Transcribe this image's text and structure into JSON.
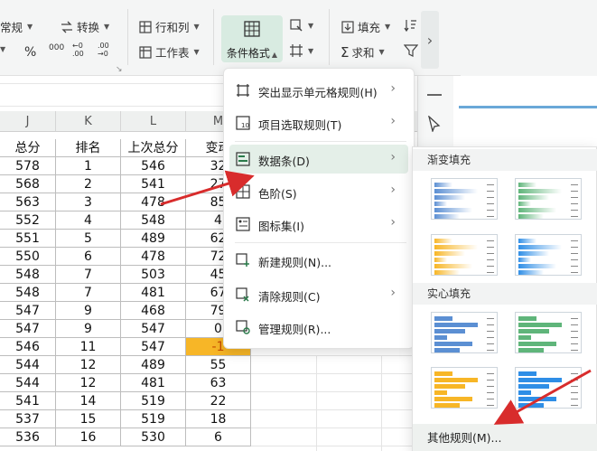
{
  "ribbon": {
    "number_format": "常规",
    "percent": "%",
    "thousands": "000",
    "dec_inc": "←0 .00",
    "dec_dec": ".00 →0",
    "convert": "转换",
    "rows_cols": "行和列",
    "worksheet": "工作表",
    "conditional_format": "条件格式",
    "fill": "填充",
    "sum": "求和"
  },
  "columns": [
    "J",
    "K",
    "L",
    "M"
  ],
  "table_headers": [
    "总分",
    "排名",
    "上次总分",
    "变动"
  ],
  "rows": [
    [
      "578",
      "1",
      "546",
      "32"
    ],
    [
      "568",
      "2",
      "541",
      "27"
    ],
    [
      "563",
      "3",
      "478",
      "85"
    ],
    [
      "552",
      "4",
      "548",
      "4"
    ],
    [
      "551",
      "5",
      "489",
      "62"
    ],
    [
      "550",
      "6",
      "478",
      "72"
    ],
    [
      "548",
      "7",
      "503",
      "45"
    ],
    [
      "548",
      "7",
      "481",
      "67"
    ],
    [
      "547",
      "9",
      "468",
      "79"
    ],
    [
      "547",
      "9",
      "547",
      "0"
    ],
    [
      "546",
      "11",
      "547",
      "-1"
    ],
    [
      "544",
      "12",
      "489",
      "55"
    ],
    [
      "544",
      "12",
      "481",
      "63"
    ],
    [
      "541",
      "14",
      "519",
      "22"
    ],
    [
      "537",
      "15",
      "519",
      "18"
    ],
    [
      "536",
      "16",
      "530",
      "6"
    ]
  ],
  "menu": [
    {
      "label": "突出显示单元格规则(H)",
      "icon": "highlight-rules-icon",
      "submenu": true
    },
    {
      "label": "项目选取规则(T)",
      "icon": "top-bottom-rules-icon",
      "submenu": true
    },
    {
      "label": "数据条(D)",
      "icon": "data-bars-icon",
      "submenu": true,
      "active": true
    },
    {
      "label": "色阶(S)",
      "icon": "color-scales-icon",
      "submenu": true
    },
    {
      "label": "图标集(I)",
      "icon": "icon-sets-icon",
      "submenu": true
    },
    {
      "label": "新建规则(N)...",
      "icon": "new-rule-icon",
      "submenu": false
    },
    {
      "label": "清除规则(C)",
      "icon": "clear-rules-icon",
      "submenu": true
    },
    {
      "label": "管理规则(R)...",
      "icon": "manage-rules-icon",
      "submenu": false
    }
  ],
  "submenu": {
    "gradient_title": "渐变填充",
    "solid_title": "实心填充",
    "other_rules": "其他规则(M)..."
  },
  "colors": {
    "blue": "#5b8fd3",
    "green": "#5fb57a",
    "orange": "#f7b627",
    "lightblue": "#2f8ee6",
    "accent": "#d8ebe1",
    "arrow": "#d82c2c"
  }
}
